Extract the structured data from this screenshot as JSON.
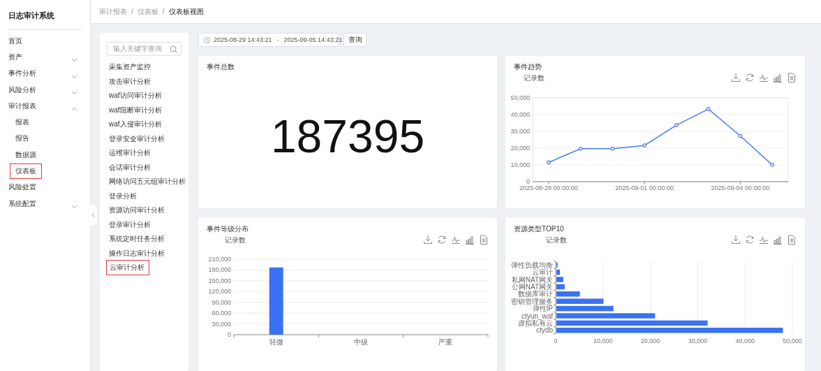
{
  "sidebar": {
    "title": "日志审计系统",
    "items": [
      {
        "label": "首页",
        "highlighted": false
      },
      {
        "label": "资产",
        "expanded": false,
        "highlighted": false
      },
      {
        "label": "事件分析",
        "expanded": false,
        "highlighted": false
      },
      {
        "label": "风险分析",
        "expanded": false,
        "highlighted": false
      },
      {
        "label": "审计报表",
        "expanded": true,
        "highlighted": false,
        "children": [
          {
            "label": "报表",
            "highlighted": false
          },
          {
            "label": "报告",
            "highlighted": false
          },
          {
            "label": "数据源",
            "highlighted": false
          },
          {
            "label": "仪表板",
            "highlighted": true
          }
        ]
      },
      {
        "label": "风险处置",
        "highlighted": false
      },
      {
        "label": "系统配置",
        "expanded": false,
        "highlighted": false
      }
    ]
  },
  "breadcrumb": [
    {
      "kind": "link",
      "text": "审计报表"
    },
    {
      "kind": "separator",
      "text": "/"
    },
    {
      "kind": "link",
      "text": "仪表板"
    },
    {
      "kind": "separator",
      "text": "/"
    },
    {
      "kind": "current",
      "text": "仪表板视图"
    }
  ],
  "nav_panel": {
    "search": {
      "placeholder": "输入关键字查询"
    },
    "items": [
      {
        "label": "采集资产监控",
        "highlighted": false
      },
      {
        "label": "攻击审计分析",
        "highlighted": false
      },
      {
        "label": "waf访问审计分析",
        "highlighted": false
      },
      {
        "label": "waf阻断审计分析",
        "highlighted": false
      },
      {
        "label": "waf入侵审计分析",
        "highlighted": false
      },
      {
        "label": "登录安全审计分析",
        "highlighted": false
      },
      {
        "label": "运维审计分析",
        "highlighted": false
      },
      {
        "label": "会话审计分析",
        "highlighted": false
      },
      {
        "label": "网络访问五元组审计分析",
        "highlighted": false
      },
      {
        "label": "登录分析",
        "highlighted": false
      },
      {
        "label": "资源访问审计分析",
        "highlighted": false
      },
      {
        "label": "登录审计分析",
        "highlighted": false
      },
      {
        "label": "系统定时任务分析",
        "highlighted": false
      },
      {
        "label": "操作日志审计分析",
        "highlighted": false
      },
      {
        "label": "云审计分析",
        "highlighted": true
      }
    ]
  },
  "filter": {
    "start": "2025-08-29 14:43:21",
    "separator": "-",
    "end": "2025-09-05 14:43:21",
    "button": "查询"
  },
  "cards": [
    {
      "kind": "number",
      "title": "事件总数",
      "value": "187395"
    },
    {
      "kind": "chart",
      "title": "事件趋势",
      "chart_data": {
        "type": "line",
        "title": "记录数",
        "grid": true,
        "categories": [
          "2025-08-29 00:00:00",
          null,
          null,
          "2025-09-01 00:00:00",
          null,
          null,
          "2025-09-04 00:00:00",
          null
        ],
        "ylim": [
          0,
          50000
        ],
        "yticks": [
          {
            "value": 0,
            "label": "0"
          },
          {
            "value": 10000,
            "label": "10,000"
          },
          {
            "value": 20000,
            "label": "20,000"
          },
          {
            "value": 30000,
            "label": "30,000"
          },
          {
            "value": 40000,
            "label": "40,000"
          },
          {
            "value": 50000,
            "label": "50,000"
          }
        ],
        "series": [
          {
            "color": "#4a7cf7",
            "marker": true,
            "values": [
              11500,
              19700,
              19700,
              21600,
              33700,
              43300,
              27300,
              10000
            ]
          }
        ]
      }
    },
    {
      "kind": "chart",
      "title": "事件等级分布",
      "chart_data": {
        "type": "bar",
        "title": "记录数",
        "grid": true,
        "categories": [
          "轻微",
          "中级",
          "严重"
        ],
        "ylim": [
          0,
          210000
        ],
        "yticks": [
          {
            "value": 0,
            "label": "0"
          },
          {
            "value": 30000,
            "label": "30,000"
          },
          {
            "value": 60000,
            "label": "60,000"
          },
          {
            "value": 90000,
            "label": "90,000"
          },
          {
            "value": 120000,
            "label": "120,000"
          },
          {
            "value": 150000,
            "label": "150,000"
          },
          {
            "value": 180000,
            "label": "180,000"
          },
          {
            "value": 210000,
            "label": "210,000"
          }
        ],
        "series": [
          {
            "color": "#3b72f2",
            "values": [
              187000,
              0,
              0
            ]
          }
        ]
      }
    },
    {
      "kind": "chart",
      "title": "资源类型TOP10",
      "chart_data": {
        "type": "bar",
        "orientation": "horizontal",
        "title": "记录数",
        "grid": true,
        "categories": [
          "弹性负载均衡",
          "云审计",
          "私网NAT网关",
          "公网NAT网关",
          "数据库审计",
          "密钥管理服务",
          "弹性IP",
          "ctyun_waf",
          "虚拟私有云",
          "ctydb"
        ],
        "xlim": [
          0,
          50000
        ],
        "xticks": [
          {
            "value": 0,
            "label": "0"
          },
          {
            "value": 10000,
            "label": "10,000"
          },
          {
            "value": 20000,
            "label": "20,000"
          },
          {
            "value": 30000,
            "label": "30,000"
          },
          {
            "value": 40000,
            "label": "40,000"
          },
          {
            "value": 50000,
            "label": "50,000"
          }
        ],
        "series": [
          {
            "color": "#3b72f2",
            "values": [
              400,
              900,
              1600,
              1900,
              5100,
              10100,
              12200,
              21000,
              32100,
              48000
            ]
          }
        ]
      }
    }
  ]
}
